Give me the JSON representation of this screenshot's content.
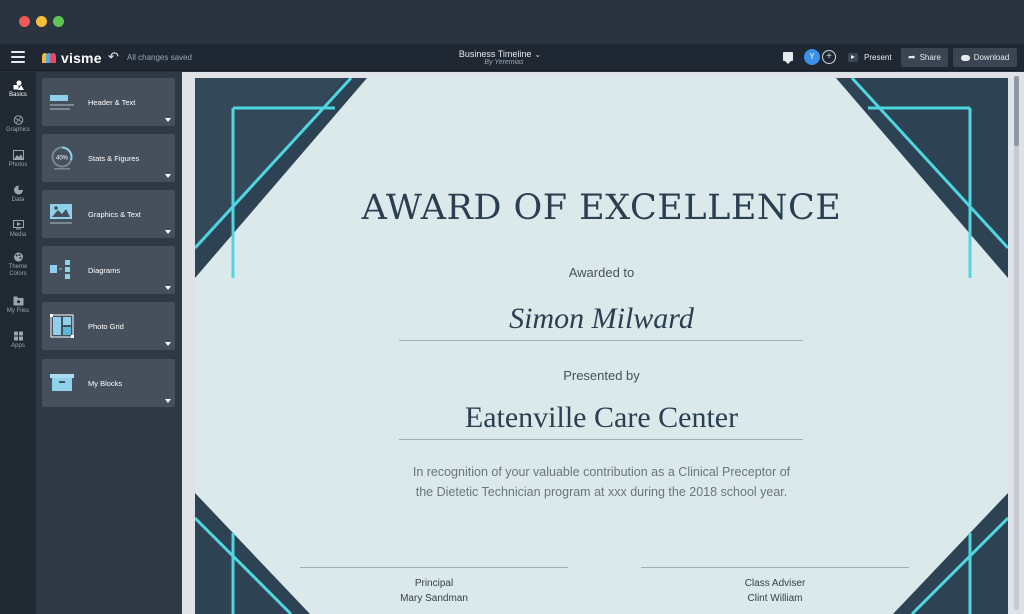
{
  "window": {
    "controls": [
      "close",
      "minimize",
      "zoom"
    ]
  },
  "toolbar": {
    "menu_icon": "hamburger-icon",
    "logo_text": "visme",
    "undo_icon": "undo-icon",
    "save_status": "All changes saved",
    "doc_title": "Business Timeline",
    "doc_author": "By Yeremias",
    "avatar_initial": "Y",
    "add_user": "+",
    "present_label": "Present",
    "share_label": "Share",
    "download_label": "Download"
  },
  "rail": {
    "items": [
      {
        "label": "Basics",
        "icon": "shapes-icon",
        "active": true
      },
      {
        "label": "Graphics",
        "icon": "graphics-icon"
      },
      {
        "label": "Photos",
        "icon": "photo-icon"
      },
      {
        "label": "Data",
        "icon": "pie-chart-icon"
      },
      {
        "label": "Media",
        "icon": "media-icon"
      },
      {
        "label": "Theme",
        "label2": "Colors",
        "icon": "palette-icon"
      },
      {
        "label": "My Files",
        "icon": "folder-icon"
      },
      {
        "label": "Apps",
        "icon": "apps-icon"
      }
    ]
  },
  "panel": {
    "cards": [
      {
        "label": "Header & Text",
        "icon": "header-text-icon"
      },
      {
        "label": "Stats & Figures",
        "icon": "stats-icon",
        "badge": "40%"
      },
      {
        "label": "Graphics & Text",
        "icon": "image-text-icon"
      },
      {
        "label": "Diagrams",
        "icon": "diagram-icon"
      },
      {
        "label": "Photo Grid",
        "icon": "photo-grid-icon"
      },
      {
        "label": "My Blocks",
        "icon": "blocks-icon"
      }
    ]
  },
  "certificate": {
    "title": "AWARD OF EXCELLENCE",
    "awarded_to_label": "Awarded to",
    "recipient": "Simon Milward",
    "presented_by_label": "Presented by",
    "organization": "Eatenville Care Center",
    "body_line1": "In recognition of your valuable contribution as a Clinical Preceptor of",
    "body_line2": "the Dietetic Technician program at xxx during the 2018 school year.",
    "signatures": [
      {
        "role": "Principal",
        "name": "Mary Sandman"
      },
      {
        "role": "Class Adviser",
        "name": "Clint William"
      }
    ],
    "colors": {
      "background": "#dbe9ea",
      "corner_dark": "#2d4354",
      "corner_line": "#4fd6de",
      "text": "#2b3f52"
    }
  }
}
